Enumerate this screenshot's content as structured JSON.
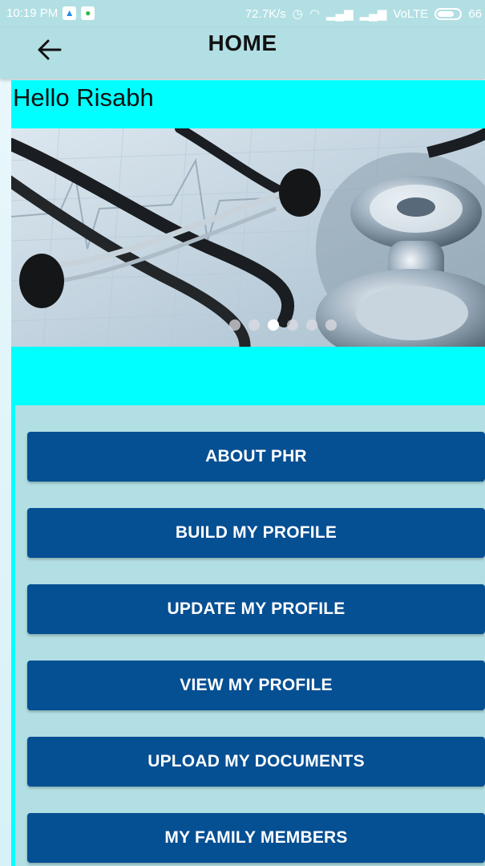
{
  "statusbar": {
    "time": "10:19 PM",
    "speed": "72.7K/s",
    "network": "VoLTE",
    "battery": "66",
    "icons": [
      "alert-icon",
      "whatsapp-icon",
      "alarm-icon",
      "wifi-icon",
      "signal-icon",
      "signal-icon",
      "battery-icon"
    ]
  },
  "appbar": {
    "title": "HOME",
    "back_icon": "arrow-left-icon"
  },
  "greeting": "Hello Risabh",
  "banner": {
    "image_subject": "stethoscope",
    "dots_total": 6,
    "active_dot": 2
  },
  "menu": [
    {
      "label": "ABOUT PHR"
    },
    {
      "label": "BUILD MY PROFILE"
    },
    {
      "label": "UPDATE MY PROFILE"
    },
    {
      "label": "VIEW MY PROFILE"
    },
    {
      "label": "UPLOAD MY DOCUMENTS"
    },
    {
      "label": "MY FAMILY MEMBERS"
    }
  ],
  "colors": {
    "appbar": "#b2dfe3",
    "content_bg": "#00ffff",
    "button": "#054f93",
    "button_text": "#ffffff"
  }
}
